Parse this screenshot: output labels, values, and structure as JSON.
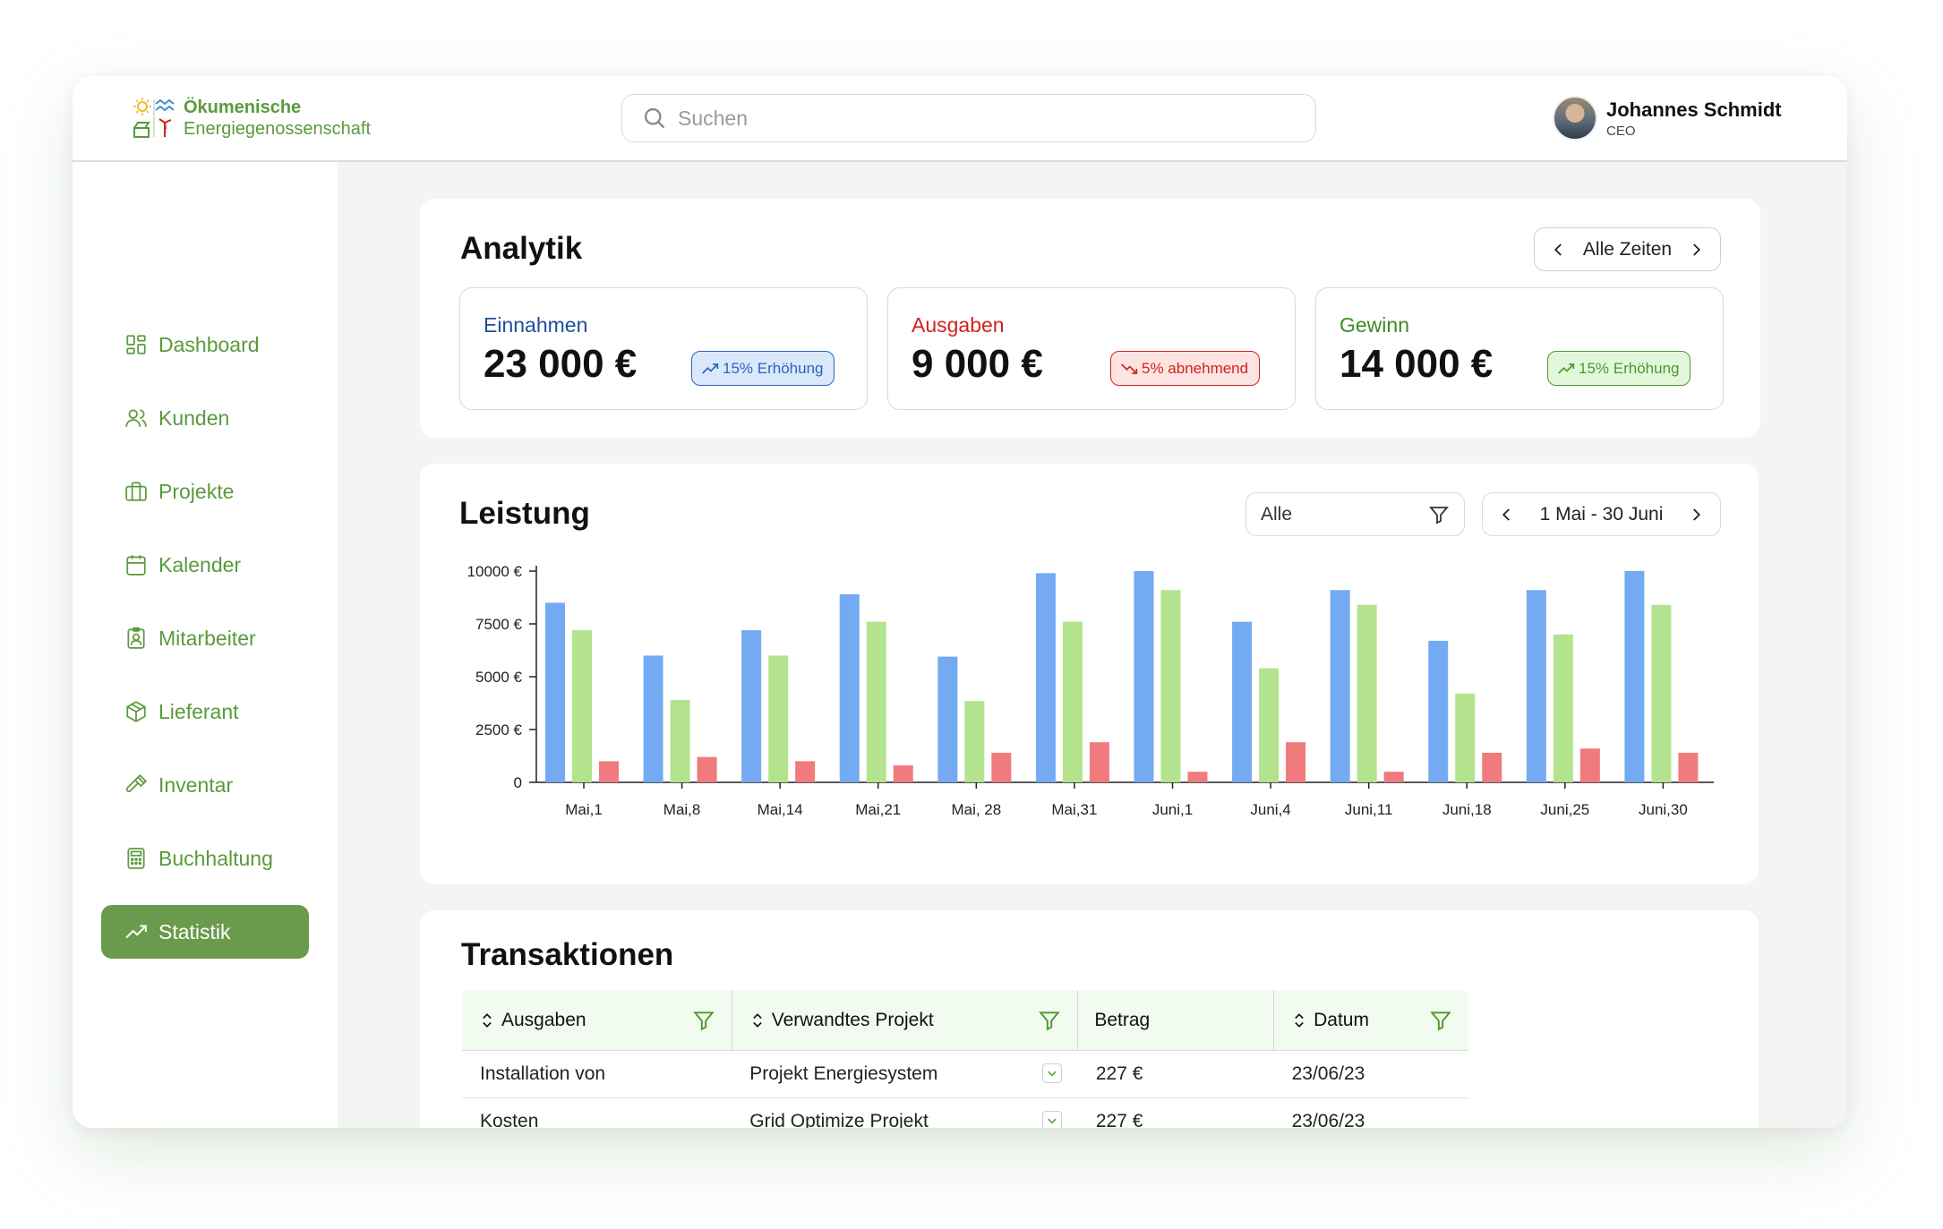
{
  "brand": {
    "line1": "Ökumenische",
    "line2": "Energiegenossenschaft"
  },
  "search": {
    "placeholder": "Suchen"
  },
  "user": {
    "name": "Johannes Schmidt",
    "role": "CEO"
  },
  "sidebar": {
    "items": [
      {
        "label": "Dashboard",
        "icon": "dashboard-icon"
      },
      {
        "label": "Kunden",
        "icon": "users-icon"
      },
      {
        "label": "Projekte",
        "icon": "briefcase-icon"
      },
      {
        "label": "Kalender",
        "icon": "calendar-icon"
      },
      {
        "label": "Mitarbeiter",
        "icon": "badge-icon"
      },
      {
        "label": "Lieferant",
        "icon": "package-icon"
      },
      {
        "label": "Inventar",
        "icon": "hammer-icon"
      },
      {
        "label": "Buchhaltung",
        "icon": "calculator-icon"
      },
      {
        "label": "Statistik",
        "icon": "trending-up-icon",
        "active": true
      }
    ]
  },
  "analytik": {
    "title": "Analytik",
    "period": "Alle Zeiten",
    "stats": [
      {
        "label": "Einnahmen",
        "value": "23 000 €",
        "badge": "15% Erhöhung",
        "trend": "up",
        "color": "#1c4f9c",
        "badge_bg": "#d9e9fb",
        "badge_border": "#2e63b8"
      },
      {
        "label": "Ausgaben",
        "value": "9 000 €",
        "badge": "5% abnehmend",
        "trend": "down",
        "color": "#d0231b",
        "badge_bg": "#fde4e3",
        "badge_border": "#d0231b"
      },
      {
        "label": "Gewinn",
        "value": "14 000 €",
        "badge": "15% Erhöhung",
        "trend": "up",
        "color": "#3f8a22",
        "badge_bg": "#e3f7da",
        "badge_border": "#4a9a2c"
      }
    ]
  },
  "leistung": {
    "title": "Leistung",
    "filter": "Alle",
    "range": "1 Mai - 30 Juni"
  },
  "chart_data": {
    "type": "bar",
    "categories": [
      "Mai,1",
      "Mai,8",
      "Mai,14",
      "Mai,21",
      "Mai, 28",
      "Mai,31",
      "Juni,1",
      "Juni,4",
      "Juni,11",
      "Juni,18",
      "Juni,25",
      "Juni,30"
    ],
    "series": [
      {
        "color": "#74aaf2",
        "values": [
          8500,
          6000,
          7200,
          8900,
          5950,
          9900,
          10000,
          7600,
          9100,
          6700,
          9100,
          10000
        ]
      },
      {
        "color": "#b4e38e",
        "values": [
          7200,
          3900,
          6000,
          7600,
          3850,
          7600,
          9100,
          5400,
          8400,
          4200,
          7000,
          8400
        ]
      },
      {
        "color": "#f07a7d",
        "values": [
          1000,
          1200,
          1000,
          800,
          1400,
          1900,
          500,
          1900,
          500,
          1400,
          1600,
          1400
        ]
      }
    ],
    "yticks": [
      "0",
      "2500 €",
      "5000 €",
      "7500 €",
      "10000 €"
    ],
    "ylim": [
      0,
      10000
    ],
    "grid": false
  },
  "transaktionen": {
    "title": "Transaktionen",
    "columns": [
      "Ausgaben",
      "Verwandtes Projekt",
      "Betrag",
      "Datum"
    ],
    "rows": [
      [
        "Installation von",
        "Projekt Energiesystem",
        "227 €",
        "23/06/23"
      ],
      [
        "Kosten",
        "Grid Optimize Projekt",
        "227 €",
        "23/06/23"
      ]
    ]
  }
}
